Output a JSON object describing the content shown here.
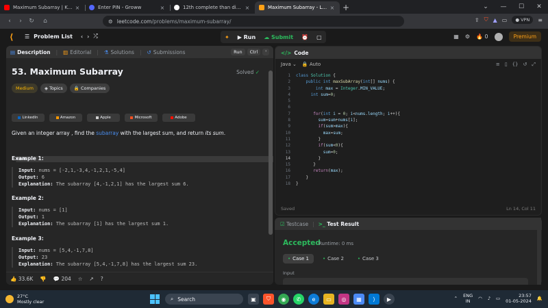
{
  "browser": {
    "tabs": [
      {
        "title": "Maximum Subarray | Kadane's Algo",
        "color": "#ff0000",
        "active": false
      },
      {
        "title": "Enter PIN - Groww",
        "color": "#5367ff",
        "active": false
      },
      {
        "title": "12th complete than diploma than yo",
        "color": "#ffffff",
        "active": false
      },
      {
        "title": "Maximum Subarray - LeetCode",
        "color": "#ffa116",
        "active": true
      }
    ],
    "url_host": "leetcode.com",
    "url_path": "/problems/maximum-subarray/",
    "vpn_label": "VPN"
  },
  "lcnav": {
    "problem_list": "Problem List",
    "run": "Run",
    "submit": "Submit",
    "streak": "0",
    "premium": "Premium"
  },
  "left": {
    "tabs": {
      "description": "Description",
      "editorial": "Editorial",
      "solutions": "Solutions",
      "submissions": "Submissions"
    },
    "run_label": "Run",
    "ctrl_label": "Ctrl",
    "quote_label": "'",
    "title": "53. Maximum Subarray",
    "solved": "Solved",
    "chips": {
      "difficulty": "Medium",
      "topics": "Topics",
      "companies": "Companies"
    },
    "companies": [
      "LinkedIn",
      "Amazon",
      "Apple",
      "Microsoft",
      "Adobe"
    ],
    "desc_pre": "Given an integer array ",
    "desc_code": "nums",
    "desc_mid": ", find the ",
    "desc_link": "subarray",
    "desc_post": " with the largest sum, and return ",
    "desc_em": "its sum",
    "desc_end": ".",
    "examples": [
      {
        "title": "Example 1:",
        "input": "nums = [-2,1,-3,4,-1,2,1,-5,4]",
        "output": "6",
        "explanation": "The subarray [4,-1,2,1] has the largest sum 6."
      },
      {
        "title": "Example 2:",
        "input": "nums = [1]",
        "output": "1",
        "explanation": "The subarray [1] has the largest sum 1."
      },
      {
        "title": "Example 3:",
        "input": "nums = [5,4,-1,7,8]",
        "output": "23",
        "explanation": "The subarray [5,4,-1,7,8] has the largest sum 23."
      }
    ],
    "labels": {
      "input": "Input:",
      "output": "Output:",
      "explanation": "Explanation:"
    },
    "likes": "33.6K",
    "comments": "204"
  },
  "code": {
    "header": "Code",
    "language": "Java",
    "mode": "Auto",
    "status": "Saved",
    "cursor": "Ln 14, Col 11"
  },
  "test": {
    "testcase_tab": "Testcase",
    "result_tab": "Test Result",
    "verdict": "Accepted",
    "runtime": "Runtime: 0 ms",
    "cases": [
      "Case 1",
      "Case 2",
      "Case 3"
    ],
    "input_label": "Input"
  },
  "taskbar": {
    "temp": "27°C",
    "weather": "Mostly clear",
    "search": "Search",
    "lang1": "ENG",
    "lang2": "IN",
    "time": "23:57",
    "date": "01-05-2024"
  }
}
